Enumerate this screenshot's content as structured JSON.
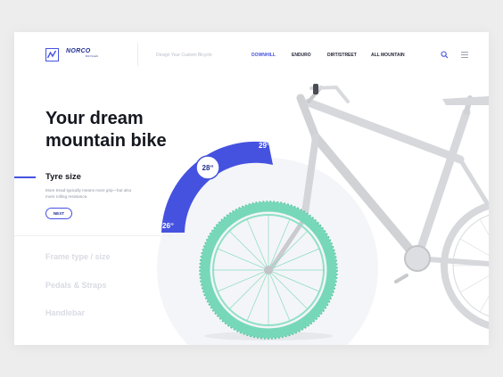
{
  "brand": {
    "name": "NORCO",
    "sub": "BICYCLES"
  },
  "header": {
    "tagline": "Design Your Custom Bicycle",
    "nav": [
      "DOWNHILL",
      "ENDURO",
      "DIRT/STREET",
      "ALL MOUNTAIN"
    ],
    "active_nav": "DOWNHILL"
  },
  "hero": {
    "title_line1": "Your dream",
    "title_line2": "mountain bike"
  },
  "section": {
    "title": "Tyre size",
    "description": "More tread typically means more grip—but also more rolling resistance.",
    "next_label": "NEXT"
  },
  "options": [
    "Frame type / size",
    "Pedals & Straps",
    "Handlebar"
  ],
  "tyre_sizes": [
    "26ˮ",
    "28ˮ",
    "29ˮ"
  ],
  "selected_tyre": "28ˮ",
  "icons": [
    "logo-mark-icon",
    "search-icon",
    "hamburger-menu-icon"
  ],
  "colors": {
    "accent": "#4552e0",
    "tyre": "#76d8b9",
    "frame": "#d6d8dc",
    "brand_dark": "#1f2d8f"
  }
}
